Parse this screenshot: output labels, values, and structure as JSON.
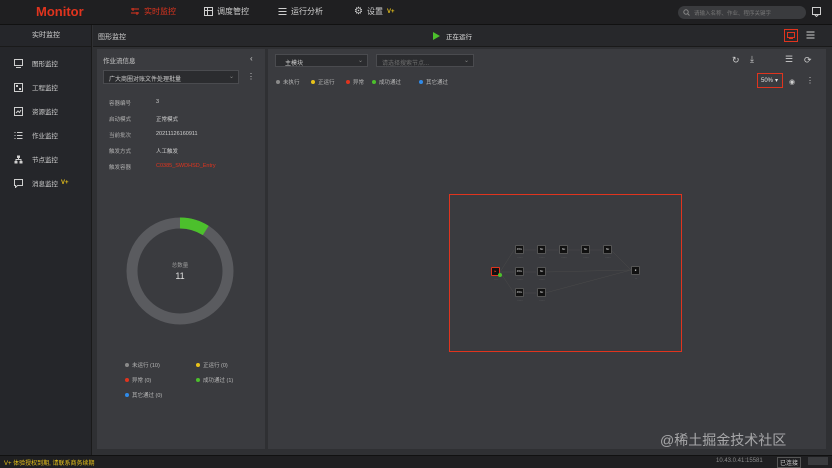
{
  "topbar": {
    "logo": "Monitor",
    "nav": [
      {
        "label": "实时监控",
        "active": true
      },
      {
        "label": "调度管控",
        "active": false
      },
      {
        "label": "运行分析",
        "active": false
      },
      {
        "label": "设置",
        "active": false,
        "badge": "V+"
      }
    ],
    "search_placeholder": "请输入名称、作业、程序关键字"
  },
  "sidebar": {
    "title": "实时监控",
    "items": [
      {
        "label": "图形监控",
        "icon": "monitor-icon"
      },
      {
        "label": "工程监控",
        "icon": "project-icon"
      },
      {
        "label": "资源监控",
        "icon": "resource-icon"
      },
      {
        "label": "作业监控",
        "icon": "job-list-icon"
      },
      {
        "label": "节点监控",
        "icon": "node-tree-icon"
      },
      {
        "label": "消息监控",
        "icon": "message-icon",
        "badge": "V+"
      }
    ]
  },
  "header": {
    "title": "图形监控",
    "status": "正在运行"
  },
  "job_panel": {
    "title": "作业流信息",
    "selected_job": "广大商圈对账文件处理批量",
    "fields": [
      {
        "key": "容器编号",
        "value": "3"
      },
      {
        "key": "启动模式",
        "value": "正常模式"
      },
      {
        "key": "当前批次",
        "value": "20211126160911"
      },
      {
        "key": "触发方式",
        "value": "人工触发"
      },
      {
        "key": "触发容器",
        "value": "C0385_SWDHSD_Entry"
      }
    ],
    "donut": {
      "label": "总数量",
      "value": "11",
      "success_fraction": 0.09
    },
    "legend": [
      {
        "label": "未运行 (10)",
        "color": "#8a8a8a"
      },
      {
        "label": "正运行 (0)",
        "color": "#e8c21a"
      },
      {
        "label": "异常 (0)",
        "color": "#e0341e"
      },
      {
        "label": "成功通过 (1)",
        "color": "#4cc02c"
      },
      {
        "label": "其它通过 (0)",
        "color": "#2f8ae8"
      }
    ]
  },
  "canvas_panel": {
    "module_select": "主模块",
    "node_select_placeholder": "请选择搜索节点...",
    "legend": [
      {
        "label": "未执行",
        "color": "#8a8a8a"
      },
      {
        "label": "正运行",
        "color": "#e8c21a"
      },
      {
        "label": "异常",
        "color": "#e0341e"
      },
      {
        "label": "成功通过",
        "color": "#4cc02c"
      },
      {
        "label": "其它通过",
        "color": "#2f8ae8"
      }
    ],
    "zoom": "50%"
  },
  "footer": {
    "left": "V+ 体验授权到期, 请联系商务续期",
    "right": "10.43.0.41:15581",
    "badge": "已连接"
  },
  "watermark": "@稀土掘金技术社区"
}
